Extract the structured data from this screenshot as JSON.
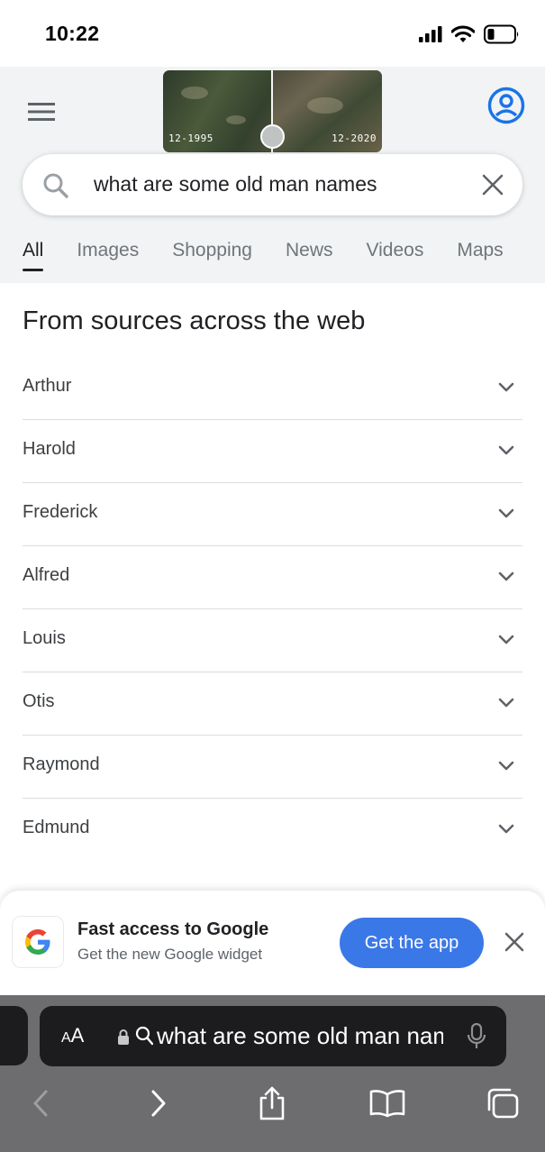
{
  "status_bar": {
    "time": "10:22"
  },
  "header": {
    "doodle": {
      "left_date": "12-1995",
      "right_date": "12-2020"
    }
  },
  "search": {
    "query": "what are some old man names"
  },
  "tabs": [
    {
      "label": "All",
      "active": true
    },
    {
      "label": "Images"
    },
    {
      "label": "Shopping"
    },
    {
      "label": "News"
    },
    {
      "label": "Videos"
    },
    {
      "label": "Maps"
    }
  ],
  "results": {
    "title": "From sources across the web",
    "items": [
      "Arthur",
      "Harold",
      "Frederick",
      "Alfred",
      "Louis",
      "Otis",
      "Raymond",
      "Edmund"
    ]
  },
  "promo": {
    "title": "Fast access to Google",
    "subtitle": "Get the new Google widget",
    "button": "Get the app"
  },
  "safari": {
    "aa_small": "A",
    "aa_large": "A",
    "address": "what are some old man names"
  },
  "colors": {
    "accent": "#3b78e7",
    "google_blue": "#1a73e8",
    "toolbar": "#6d6d70"
  },
  "icons": [
    "signal-icon",
    "wifi-icon",
    "battery-icon",
    "menu-icon",
    "account-icon",
    "search-icon",
    "close-icon",
    "chevron-down-icon",
    "google-logo-icon",
    "lock-icon",
    "microphone-icon",
    "back-icon",
    "forward-icon",
    "share-icon",
    "bookmarks-icon",
    "tabs-icon"
  ]
}
